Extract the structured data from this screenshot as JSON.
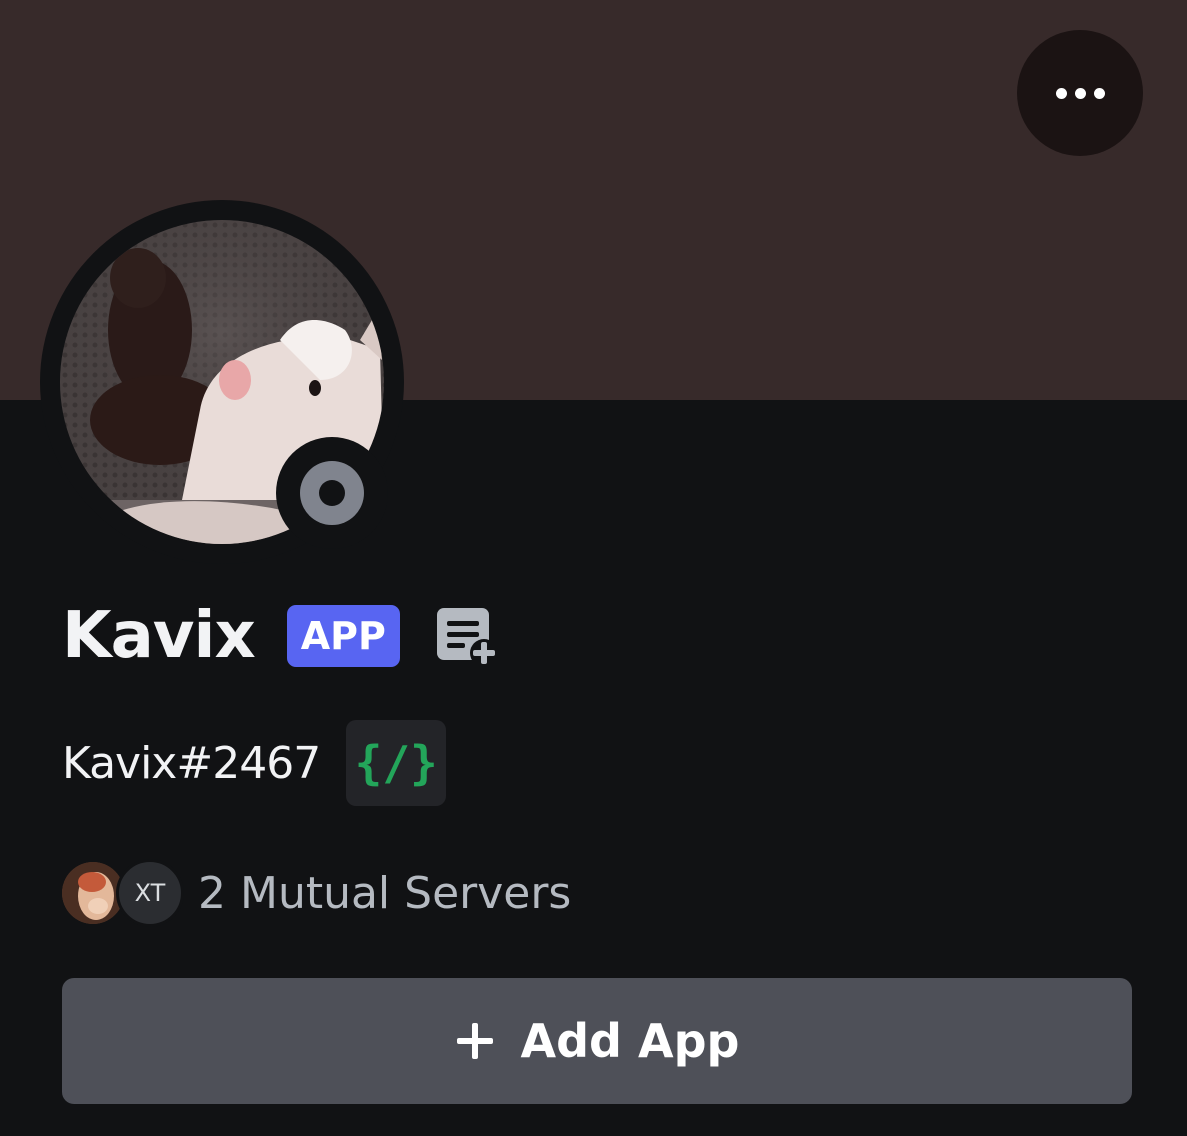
{
  "profile": {
    "display_name": "Kavix",
    "badge_label": "APP",
    "username": "Kavix#2467",
    "developer_badge": "{/}",
    "status": "offline"
  },
  "mutual": {
    "server_2_initials": "XT",
    "label": "2 Mutual Servers"
  },
  "actions": {
    "add_app_label": "Add App"
  },
  "colors": {
    "banner": "#372a2a",
    "background": "#111214",
    "app_badge": "#5865f2",
    "developer_badge_text": "#23a55a",
    "button": "#4e5058"
  },
  "icons": {
    "more": "more-options-icon",
    "slash_commands": "slash-commands-icon",
    "add": "plus-icon"
  }
}
